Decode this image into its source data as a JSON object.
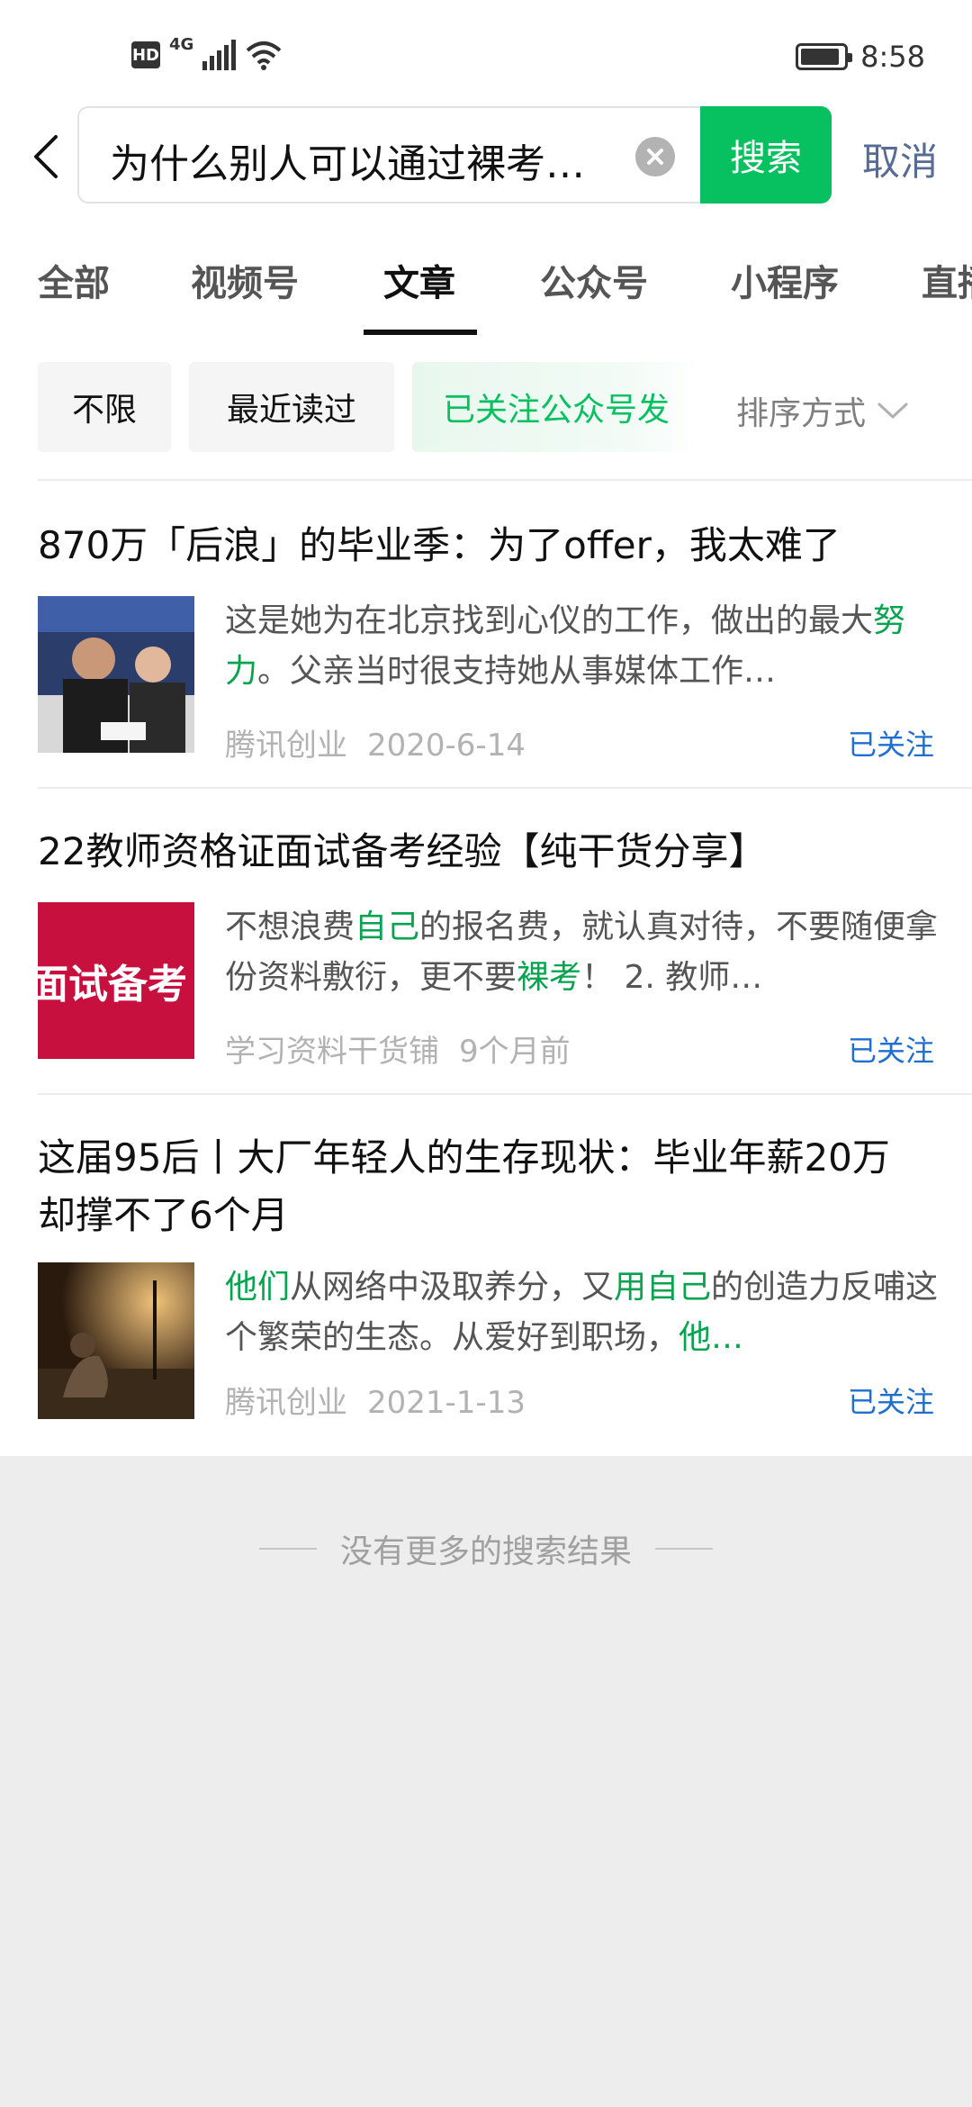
{
  "status": {
    "hd": "HD",
    "network": "4G",
    "time": "8:58"
  },
  "search": {
    "query": "为什么别人可以通过裸考…",
    "button_label": "搜索",
    "cancel_label": "取消"
  },
  "tabs": [
    {
      "label": "全部"
    },
    {
      "label": "视频号"
    },
    {
      "label": "文章"
    },
    {
      "label": "公众号"
    },
    {
      "label": "小程序"
    },
    {
      "label": "直播"
    }
  ],
  "active_tab": "文章",
  "filters": {
    "chips": [
      {
        "label": "不限"
      },
      {
        "label": "最近读过"
      },
      {
        "label": "已关注公众号发"
      }
    ],
    "sort_label": "排序方式"
  },
  "results": [
    {
      "title": "870万「后浪」的毕业季：为了offer，我太难了",
      "desc_parts": [
        {
          "t": "这是她为在北京找到心仪的工作，做出的最大"
        },
        {
          "t": "努力",
          "hl": true
        },
        {
          "t": "。父亲当时很支持她从事媒体工作…"
        }
      ],
      "source": "腾讯创业",
      "date": "2020-6-14",
      "follow": "已关注",
      "thumb_icon": "photo-students-icon"
    },
    {
      "title": "22教师资格证面试备考经验【纯干货分享】",
      "desc_parts": [
        {
          "t": "不想浪费"
        },
        {
          "t": "自己",
          "hl": true
        },
        {
          "t": "的报名费，就认真对待，不要随便拿份资料敷衍，更不要"
        },
        {
          "t": "裸考",
          "hl": true
        },
        {
          "t": "！ 2. 教师…"
        }
      ],
      "source": "学习资料干货铺",
      "date": "9个月前",
      "follow": "已关注",
      "thumb_text": "面试备考"
    },
    {
      "title": "这届95后丨大厂年轻人的生存现状：毕业年薪20万 却撑不了6个月",
      "desc_parts": [
        {
          "t": "他们",
          "hl": true
        },
        {
          "t": "从网络中汲取养分，又"
        },
        {
          "t": "用自己",
          "hl": true
        },
        {
          "t": "的创造力反哺这个繁荣的生态。从爱好到职场，"
        },
        {
          "t": "他…",
          "hl": true
        }
      ],
      "source": "腾讯创业",
      "date": "2021-1-13",
      "follow": "已关注",
      "thumb_icon": "photo-night-street-icon"
    }
  ],
  "footer": {
    "no_more": "没有更多的搜索结果"
  },
  "colors": {
    "accent": "#07c160",
    "link": "#576b95",
    "follow": "#1e6fcf",
    "highlight": "#07a34f"
  }
}
